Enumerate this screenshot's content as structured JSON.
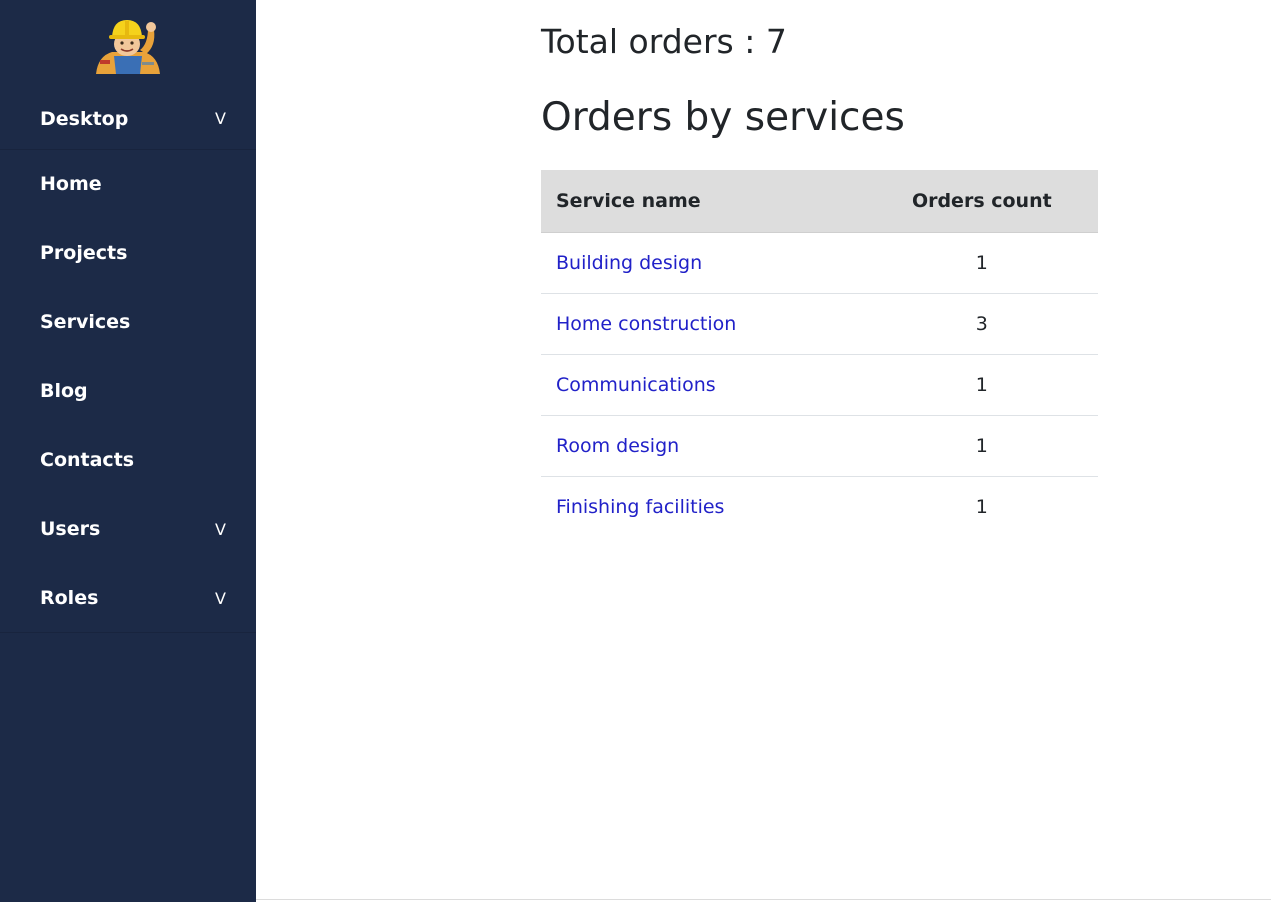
{
  "sidebar": {
    "logo": "builder-mascot-logo",
    "items": [
      {
        "label": "Desktop",
        "has_submenu": true,
        "chevron": "V"
      },
      {
        "label": "Home",
        "has_submenu": false
      },
      {
        "label": "Projects",
        "has_submenu": false
      },
      {
        "label": "Services",
        "has_submenu": false
      },
      {
        "label": "Blog",
        "has_submenu": false
      },
      {
        "label": "Contacts",
        "has_submenu": false
      },
      {
        "label": "Users",
        "has_submenu": true,
        "chevron": "V"
      },
      {
        "label": "Roles",
        "has_submenu": true,
        "chevron": "V"
      }
    ]
  },
  "main": {
    "total_orders": "Total orders : 7",
    "section_title": "Orders by services",
    "table": {
      "headers": [
        "Service name",
        "Orders count"
      ],
      "rows": [
        {
          "service": "Building design",
          "count": "1"
        },
        {
          "service": "Home construction",
          "count": "3"
        },
        {
          "service": "Communications",
          "count": "1"
        },
        {
          "service": "Room design",
          "count": "1"
        },
        {
          "service": "Finishing facilities",
          "count": "1"
        }
      ]
    }
  },
  "colors": {
    "sidebar_bg": "#1c2a47",
    "header_bg": "#dddddd",
    "link": "#2121c8",
    "text": "#212529"
  }
}
